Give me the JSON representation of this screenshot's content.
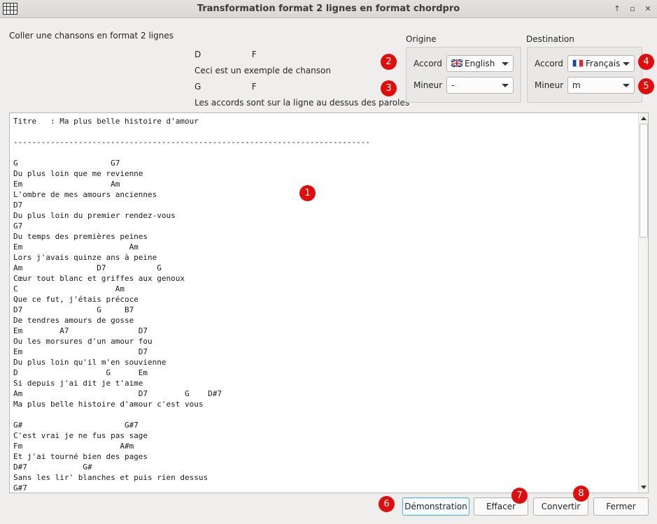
{
  "window": {
    "title": "Transformation format 2 lignes en format chordpro",
    "controls": {
      "up": "↑",
      "restore": "▫",
      "close": "✕"
    }
  },
  "intro": {
    "heading": "Coller une chansons en format 2 lignes",
    "example_chords_1": "D                   F",
    "example_lyrics_1": "Ceci est un exemple de chanson",
    "example_chords_2": "G                   F",
    "example_lyrics_2": "Les accords sont sur la ligne au dessus des paroles"
  },
  "origine": {
    "title": "Origine",
    "accord_label": "Accord",
    "accord_value": "English",
    "accord_flag": "uk-flag-icon",
    "mineur_label": "Mineur",
    "mineur_value": "-"
  },
  "destination": {
    "title": "Destination",
    "accord_label": "Accord",
    "accord_value": "Français",
    "accord_flag": "fr-flag-icon",
    "mineur_label": "Mineur",
    "mineur_value": "m"
  },
  "editor": {
    "content": "Titre   : Ma plus belle histoire d'amour\n\n-----------------------------------------------------------------------------\n\nG                    G7\nDu plus loin que me revienne\nEm                   Am\nL'ombre de mes amours anciennes\nD7\nDu plus loin du premier rendez-vous\nG7\nDu temps des premières peines\nEm                       Am\nLors j'avais quinze ans à peine\nAm                D7           G\nCœur tout blanc et griffes aux genoux\nC                     Am\nQue ce fut, j'étais précoce\nD7                G     B7\nDe tendres amours de gosse\nEm        A7               D7\nOu les morsures d'un amour fou\nEm                         D7\nDu plus loin qu'il m'en souvienne\nD                   G      Em\nSi depuis j'ai dit je t'aime\nAm                         D7        G    D#7\nMa plus belle histoire d'amour c'est vous\n\nG#                      G#7\nC'est vrai je ne fus pas sage\nFm                     A#m\nEt j'ai tourné bien des pages\nD#7            G#\nSans les lir' blanches et puis rien dessus\nG#7"
  },
  "buttons": {
    "demo": "Démonstration",
    "clear": "Effacer",
    "convert": "Convertir",
    "close": "Fermer"
  },
  "badges": {
    "b1": "1",
    "b2": "2",
    "b3": "3",
    "b4": "4",
    "b5": "5",
    "b6": "6",
    "b7": "7",
    "b8": "8"
  },
  "colors": {
    "badge": "#e00d0d",
    "focus": "#3daee9"
  }
}
